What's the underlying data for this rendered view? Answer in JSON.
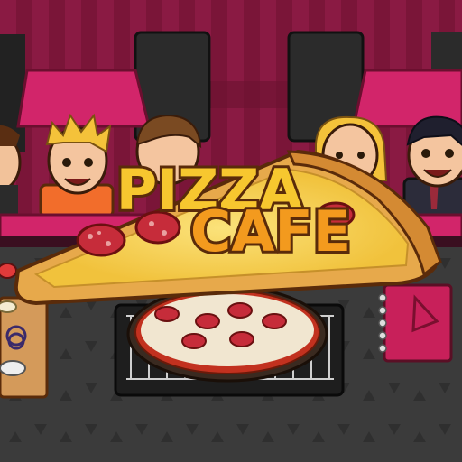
{
  "game": {
    "logo": {
      "line1": "PIZZA",
      "line2": "CAFE",
      "colors": {
        "fill": "#f7c72f",
        "fill2": "#f39a1e",
        "outline": "#5a2b0a"
      }
    },
    "customers": [
      {
        "name": "customer-left-edge",
        "hair": "brown"
      },
      {
        "name": "customer-orange-spiky",
        "hair": "blonde"
      },
      {
        "name": "customer-brown-hair",
        "hair": "brown"
      },
      {
        "name": "customer-blonde-woman",
        "hair": "blonde"
      },
      {
        "name": "customer-businessman",
        "hair": "black"
      }
    ],
    "items": {
      "order-book": "notebook-icon",
      "pizza-oven": "pizza-icon",
      "toppings-station": "toppings-icon"
    },
    "palette": {
      "wall": "#7a1538",
      "wall_stripe": "#8e1b44",
      "counter": "#d2256a",
      "floor": "#3a3a3a",
      "crust": "#e7a94b",
      "cheese": "#f7d55a",
      "pepperoni": "#c62c3a"
    }
  }
}
